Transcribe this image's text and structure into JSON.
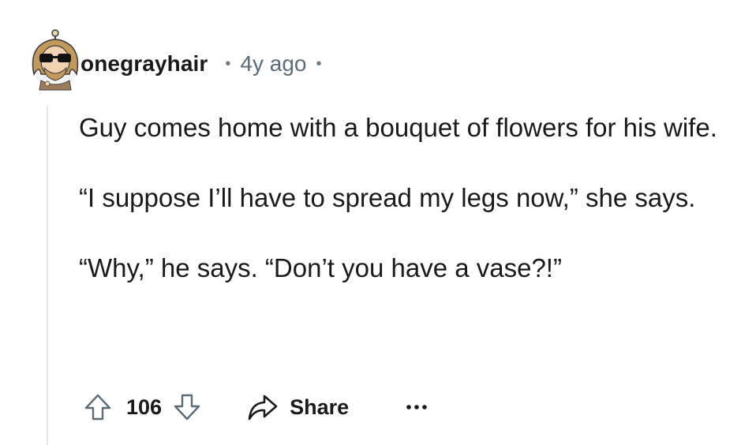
{
  "comment": {
    "username": "onegrayhair",
    "separator": "•",
    "timestamp": "4y ago",
    "paragraphs": [
      "Guy comes home with a bouquet of flowers for his wife.",
      "“I suppose I’ll have to spread my legs now,” she says.",
      "“Why,” he says. “Don’t you have a vase?!”"
    ]
  },
  "actions": {
    "upvote_icon": "arrow-up-outline-icon",
    "score": "106",
    "downvote_icon": "arrow-down-outline-icon",
    "share_icon": "share-arrow-icon",
    "share_label": "Share",
    "more_icon": "ellipsis-icon"
  },
  "colors": {
    "text": "#1a1a1b",
    "meta": "#5c6c77",
    "thread_line": "#e5e8ea",
    "icon": "#5c6c77"
  }
}
